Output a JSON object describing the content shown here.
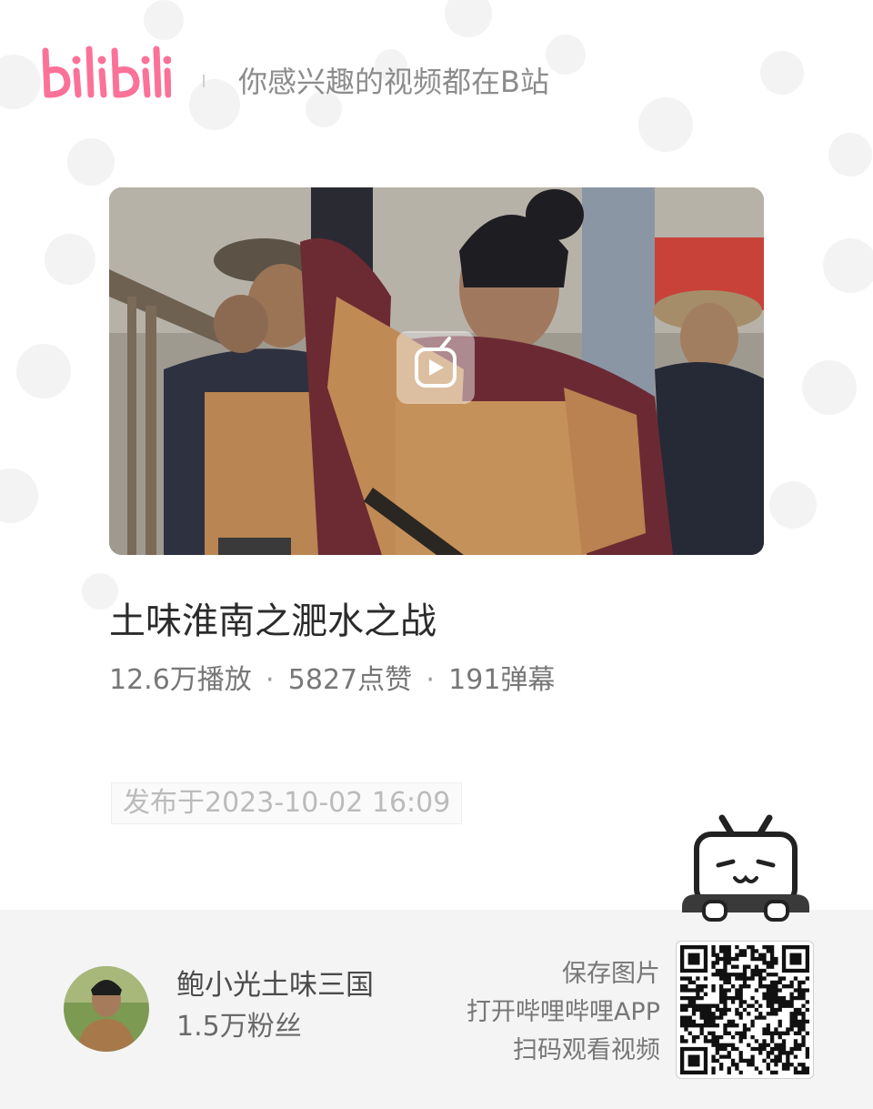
{
  "header": {
    "logo_text": "bilibili",
    "slogan": "你感兴趣的视频都在B站"
  },
  "video": {
    "cover_icon": "play-icon",
    "title": "土味淮南之淝水之战",
    "stats": {
      "plays": "12.6万播放",
      "likes": "5827点赞",
      "danmaku": "191弹幕",
      "separator": "·"
    },
    "publish_time": "发布于2023-10-02 16:09"
  },
  "footer": {
    "uploader": {
      "name": "鲍小光土味三国",
      "fans": "1.5万粉丝"
    },
    "cta_lines": [
      "保存图片",
      "打开哔哩哔哩APP",
      "扫码观看视频"
    ],
    "qr_icon": "qr-code-icon",
    "mascot_icon": "tv-mascot-icon"
  },
  "colors": {
    "brand_pink": "#fb7299",
    "footer_bg": "#f4f4f4",
    "text_dark": "#2b2b2b",
    "text_muted": "#777777"
  }
}
